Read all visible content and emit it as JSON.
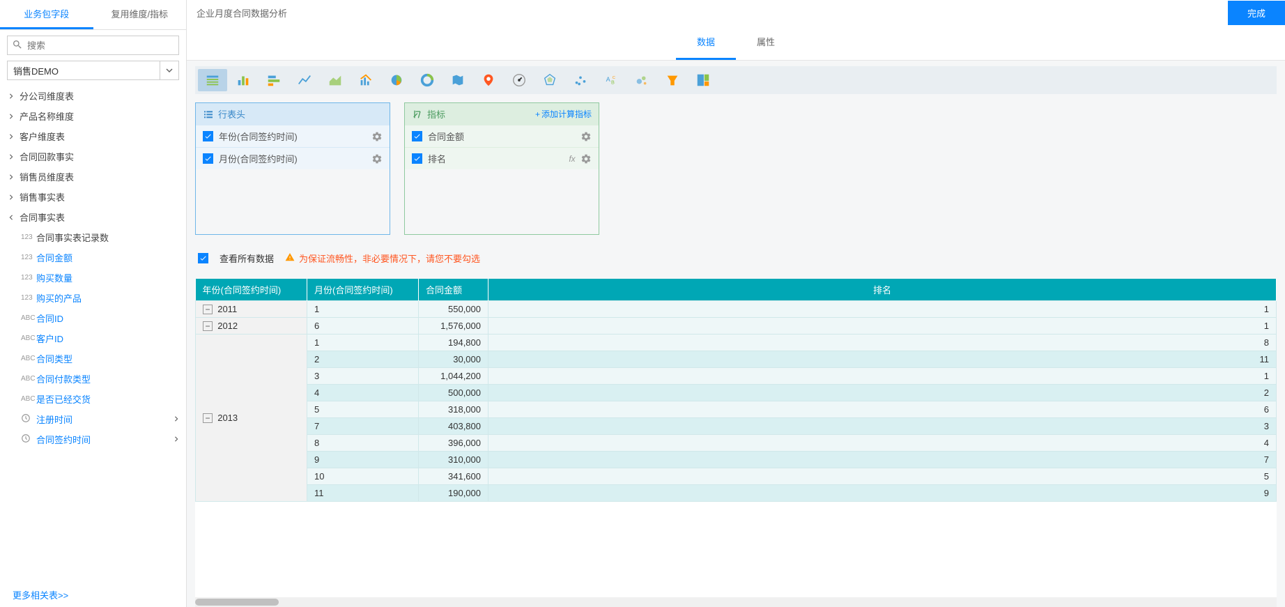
{
  "sidebar": {
    "tabs": {
      "fields": "业务包字段",
      "reuse": "复用维度/指标"
    },
    "search_placeholder": "搜索",
    "package_select": "销售DEMO",
    "tree": [
      {
        "label": "分公司维度表",
        "expanded": false
      },
      {
        "label": "产品名称维度",
        "expanded": false
      },
      {
        "label": "客户维度表",
        "expanded": false
      },
      {
        "label": "合同回款事实",
        "expanded": false
      },
      {
        "label": "销售员维度表",
        "expanded": false
      },
      {
        "label": "销售事实表",
        "expanded": false
      },
      {
        "label": "合同事实表",
        "expanded": true,
        "children": [
          {
            "type": "123",
            "label": "合同事实表记录数",
            "dark": true
          },
          {
            "type": "123",
            "label": "合同金额"
          },
          {
            "type": "123",
            "label": "购买数量"
          },
          {
            "type": "123",
            "label": "购买的产品"
          },
          {
            "type": "ABC",
            "label": "合同ID"
          },
          {
            "type": "ABC",
            "label": "客户ID"
          },
          {
            "type": "ABC",
            "label": "合同类型"
          },
          {
            "type": "ABC",
            "label": "合同付款类型"
          },
          {
            "type": "ABC",
            "label": "是否已经交货"
          },
          {
            "type": "time",
            "label": "注册时间",
            "expandable": true
          },
          {
            "type": "time",
            "label": "合同签约时间",
            "expandable": true
          }
        ]
      }
    ],
    "more_link": "更多相关表>>"
  },
  "header": {
    "title": "企业月度合同数据分析",
    "done": "完成"
  },
  "center_tabs": {
    "data": "数据",
    "attr": "属性"
  },
  "config": {
    "row_header": {
      "title": "行表头",
      "items": [
        "年份(合同签约时间)",
        "月份(合同签约时间)"
      ]
    },
    "measure": {
      "title": "指标",
      "add": "添加计算指标",
      "items": [
        {
          "label": "合同金额",
          "fx": false
        },
        {
          "label": "排名",
          "fx": true
        }
      ]
    }
  },
  "view_all": {
    "label": "查看所有数据",
    "warning": "为保证流畅性，非必要情况下，请您不要勾选"
  },
  "table": {
    "headers": [
      "年份(合同签约时间)",
      "月份(合同签约时间)",
      "合同金额",
      "排名"
    ],
    "groups": [
      {
        "year": "2011",
        "rows": [
          {
            "month": "1",
            "amount": "550,000",
            "rank": "1"
          }
        ]
      },
      {
        "year": "2012",
        "rows": [
          {
            "month": "6",
            "amount": "1,576,000",
            "rank": "1"
          }
        ]
      },
      {
        "year": "2013",
        "rows": [
          {
            "month": "1",
            "amount": "194,800",
            "rank": "8"
          },
          {
            "month": "2",
            "amount": "30,000",
            "rank": "11"
          },
          {
            "month": "3",
            "amount": "1,044,200",
            "rank": "1"
          },
          {
            "month": "4",
            "amount": "500,000",
            "rank": "2"
          },
          {
            "month": "5",
            "amount": "318,000",
            "rank": "6"
          },
          {
            "month": "7",
            "amount": "403,800",
            "rank": "3"
          },
          {
            "month": "8",
            "amount": "396,000",
            "rank": "4"
          },
          {
            "month": "9",
            "amount": "310,000",
            "rank": "7"
          },
          {
            "month": "10",
            "amount": "341,600",
            "rank": "5"
          },
          {
            "month": "11",
            "amount": "190,000",
            "rank": "9"
          }
        ]
      }
    ]
  }
}
